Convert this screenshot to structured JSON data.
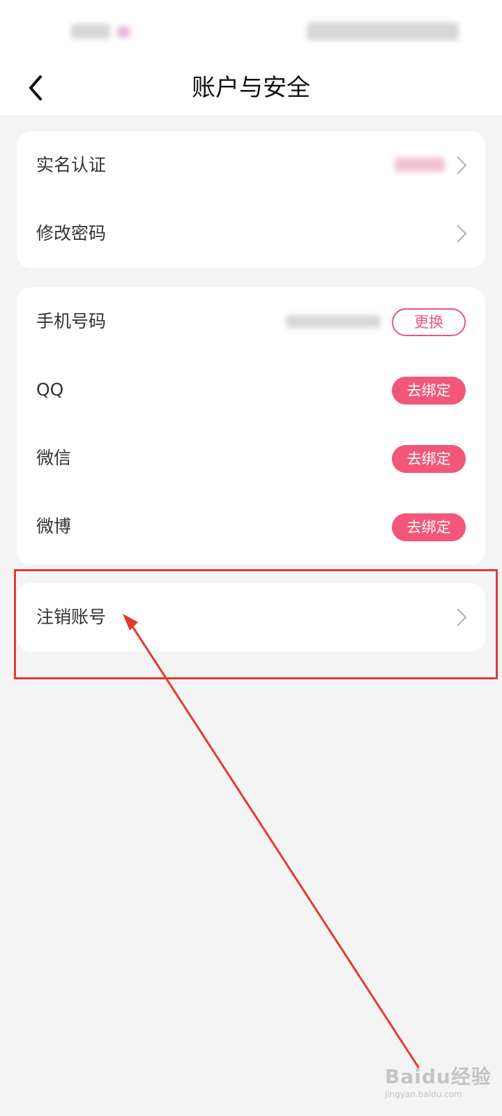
{
  "header": {
    "title": "账户与安全",
    "back_icon": "chevron-left-icon"
  },
  "card1": {
    "rows": [
      {
        "label": "实名认证"
      },
      {
        "label": "修改密码"
      }
    ]
  },
  "card2": {
    "rows": [
      {
        "label": "手机号码",
        "button": "更换"
      },
      {
        "label": "QQ",
        "button": "去绑定"
      },
      {
        "label": "微信",
        "button": "去绑定"
      },
      {
        "label": "微博",
        "button": "去绑定"
      }
    ]
  },
  "card3": {
    "rows": [
      {
        "label": "注销账号"
      }
    ]
  },
  "watermark": {
    "main": "Baidu经验",
    "sub": "jingyan.baidu.com"
  },
  "colors": {
    "accent": "#f2577a",
    "highlight": "#e53a2f",
    "background": "#f4f4f4"
  }
}
